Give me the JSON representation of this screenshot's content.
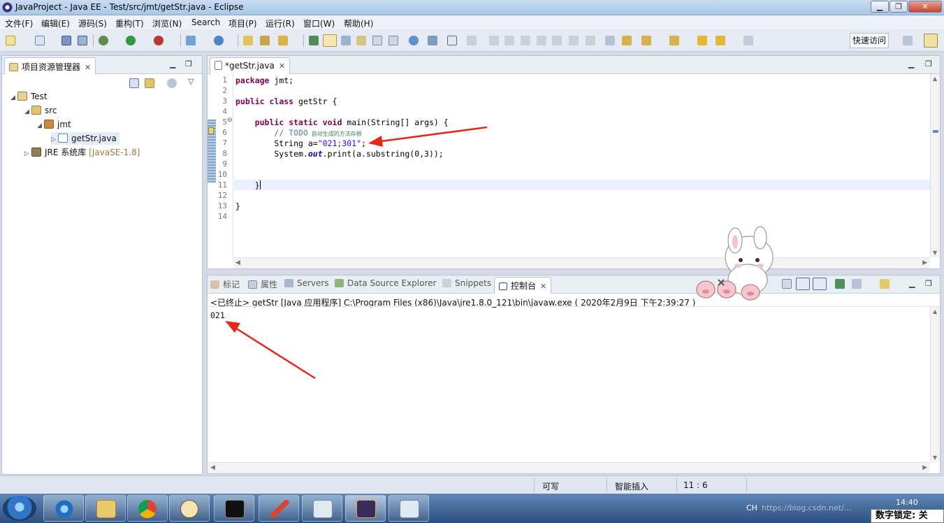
{
  "window": {
    "title": "JavaProject - Java EE - Test/src/jmt/getStr.java - Eclipse"
  },
  "menu": [
    "文件(F)",
    "编辑(E)",
    "源码(S)",
    "重构(T)",
    "浏览(N)",
    "Search",
    "项目(P)",
    "运行(R)",
    "窗口(W)",
    "帮助(H)"
  ],
  "toolbar": {
    "quick_access": "快速访问"
  },
  "explorer": {
    "tab_label": "项目资源管理器",
    "tree": {
      "project": "Test",
      "src": "src",
      "package": "jmt",
      "file": "getStr.java",
      "jre": "JRE 系统库",
      "jre_version": "[JavaSE-1.8]"
    }
  },
  "editor": {
    "tab_label": "*getStr.java",
    "line_numbers": [
      "1",
      "2",
      "3",
      "4",
      "5",
      "6",
      "7",
      "8",
      "9",
      "10",
      "11",
      "12",
      "13",
      "14"
    ],
    "code": {
      "l1_kw": "package",
      "l1_rest": " jmt;",
      "l3_kw1": "public",
      "l3_kw2": "class",
      "l3_rest": " getStr {",
      "l5_indent": "    ",
      "l5_kw1": "public",
      "l5_kw2": "static",
      "l5_kw3": "void",
      "l5_rest": " main(String[] args) {",
      "l6_indent": "        ",
      "l6_comment": "// ",
      "l6_todo": "TODO",
      "l6_note": " 自动生成的方法存根",
      "l7_a": "        String a=",
      "l7_str": "\"021;301\"",
      "l7_b": ";",
      "l8_a": "        System.",
      "l8_out": "out",
      "l8_b": ".print(a.substring(0,3));",
      "l11": "    }",
      "l13": "}"
    }
  },
  "console": {
    "tabs": [
      "标记",
      "属性",
      "Servers",
      "Data Source Explorer",
      "Snippets",
      "控制台"
    ],
    "terminated_line": "<已终止> getStr [Java 应用程序] C:\\Program Files (x86)\\Java\\jre1.8.0_121\\bin\\javaw.exe ( 2020年2月9日 下午2:39:27 )",
    "output": "021"
  },
  "status": {
    "writable": "可写",
    "insert_mode": "智能插入",
    "position": "11 : 6"
  },
  "taskbar": {
    "clock": "14:40",
    "lang": "CH",
    "watermark": "https://blog.csdn.net/...",
    "numlock": "数字锁定: 关"
  },
  "colors": {
    "arrow": "#e8261a",
    "keyword": "#7f0055",
    "string": "#2a00ff"
  }
}
